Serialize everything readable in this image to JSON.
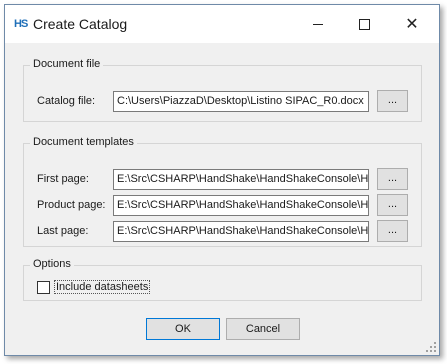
{
  "window": {
    "title": "Create Catalog",
    "app_icon_text": "HS",
    "app_icon_color": "#1f6fb8",
    "icons": [
      "minimize-icon",
      "maximize-icon",
      "close-icon"
    ],
    "close_glyph": "✕"
  },
  "document_file": {
    "legend": "Document file",
    "catalog_label": "Catalog file:",
    "catalog_value": "C:\\Users\\PiazzaD\\Desktop\\Listino SIPAC_R0.docx",
    "browse_label": "..."
  },
  "templates": {
    "legend": "Document templates",
    "rows": [
      {
        "label": "First page:",
        "value": "E:\\Src\\CSHARP\\HandShake\\HandShakeConsole\\Han",
        "browse": "..."
      },
      {
        "label": "Product page:",
        "value": "E:\\Src\\CSHARP\\HandShake\\HandShakeConsole\\Han",
        "browse": "..."
      },
      {
        "label": "Last page:",
        "value": "E:\\Src\\CSHARP\\HandShake\\HandShakeConsole\\Han",
        "browse": "..."
      }
    ]
  },
  "options": {
    "legend": "Options",
    "include_datasheets_label": "Include datasheets",
    "include_datasheets_checked": false
  },
  "buttons": {
    "ok": "OK",
    "cancel": "Cancel"
  }
}
